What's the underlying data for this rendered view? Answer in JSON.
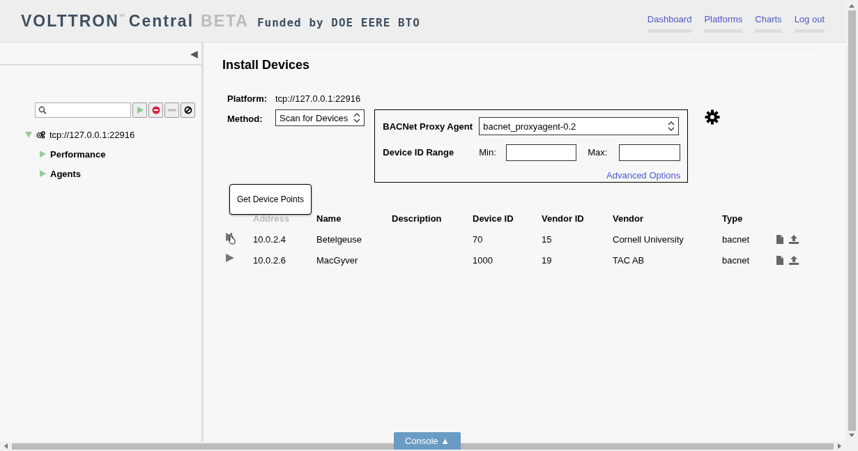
{
  "header": {
    "brand": "VOLTTRON",
    "trademark": "™",
    "product": "Central",
    "stage": "BETA",
    "funding": "Funded by DOE EERE BTO",
    "nav": [
      "Dashboard",
      "Platforms",
      "Charts",
      "Log out"
    ]
  },
  "sidebar": {
    "collapse_icon": "◀",
    "tree": [
      {
        "label": "tcp://127.0.0.1:22916",
        "expanded": true,
        "children": [
          {
            "label": "Performance",
            "expanded": false
          },
          {
            "label": "Agents",
            "expanded": false
          }
        ]
      }
    ]
  },
  "page": {
    "title": "Install Devices",
    "platform_label": "Platform:",
    "platform": "tcp://127.0.0.1:22916",
    "method_label": "Method:",
    "method": "Scan for Devices",
    "proxy_label": "BACNet Proxy Agent",
    "proxy": "bacnet_proxyagent-0.2",
    "range_label": "Device ID Range",
    "min_label": "Min:",
    "max_label": "Max:",
    "advanced": "Advanced Options",
    "tooltip": "Get Device Points",
    "columns": [
      "Address",
      "Name",
      "Description",
      "Device ID",
      "Vendor ID",
      "Vendor",
      "Type"
    ],
    "rows": [
      {
        "cells": [
          "10.0.2.4",
          "Betelgeuse",
          "",
          "70",
          "15",
          "Cornell University",
          "bacnet"
        ],
        "hovered": true
      },
      {
        "cells": [
          "10.0.2.6",
          "MacGyver",
          "",
          "1000",
          "19",
          "TAC AB",
          "bacnet"
        ],
        "hovered": false
      }
    ]
  },
  "console": {
    "label": "Console ▲"
  }
}
